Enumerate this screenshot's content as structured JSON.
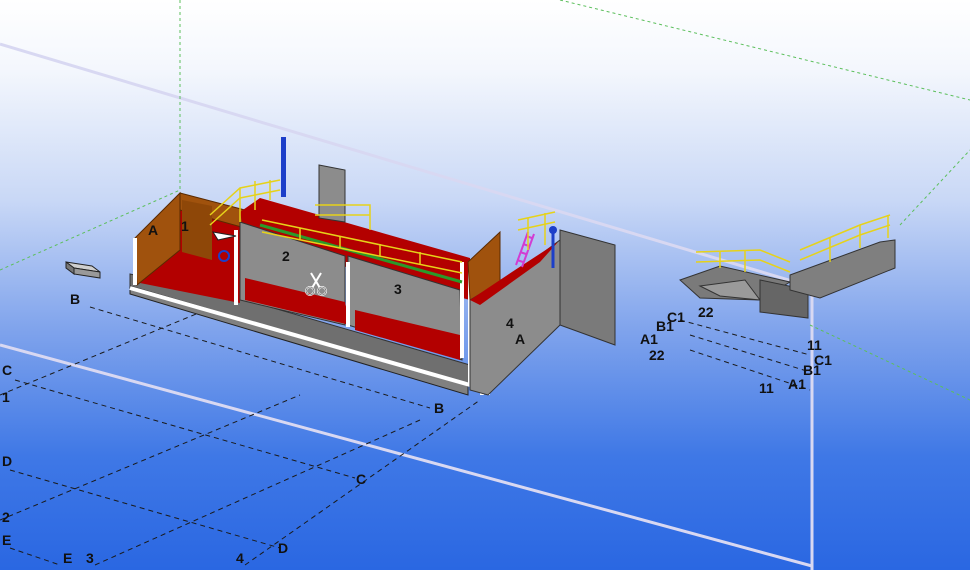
{
  "colors": {
    "concrete": "#8a8a8a",
    "concrete_dark": "#6f6f6f",
    "floor_red": "#b30000",
    "wall_brown": "#a0520d",
    "railing_yellow": "#e6d21a",
    "steel_green": "#2a9a2a",
    "pipe_blue": "#1c3fc9",
    "stair_magenta": "#d23cd2",
    "grid_line": "#1a1a1a",
    "bbox_line": "#d8d8f2"
  },
  "grid_labels": {
    "B_left": "B",
    "C_left": "C",
    "one_left": "1",
    "D_left": "D",
    "two_left": "2",
    "E_left": "E",
    "E_bottom": "E",
    "three_bottom": "3",
    "four_bottom": "4",
    "D_bottom": "D",
    "C_mid": "C",
    "B_mid": "B"
  },
  "part_labels": {
    "A_wall": "A",
    "one_wall": "1",
    "two_room": "2",
    "three_room": "3",
    "four_end": "4",
    "A_end": "A"
  },
  "right_labels": {
    "C1": "C1",
    "B1": "B1",
    "A1": "A1",
    "n22_top": "22",
    "n22_bottom": "22",
    "n11_top": "11",
    "n11_bottom": "11",
    "C1_lower": "C1",
    "B1_lower": "B1",
    "A1_lower": "A1"
  },
  "icons": {
    "cut_tool": "scissors-icon"
  }
}
